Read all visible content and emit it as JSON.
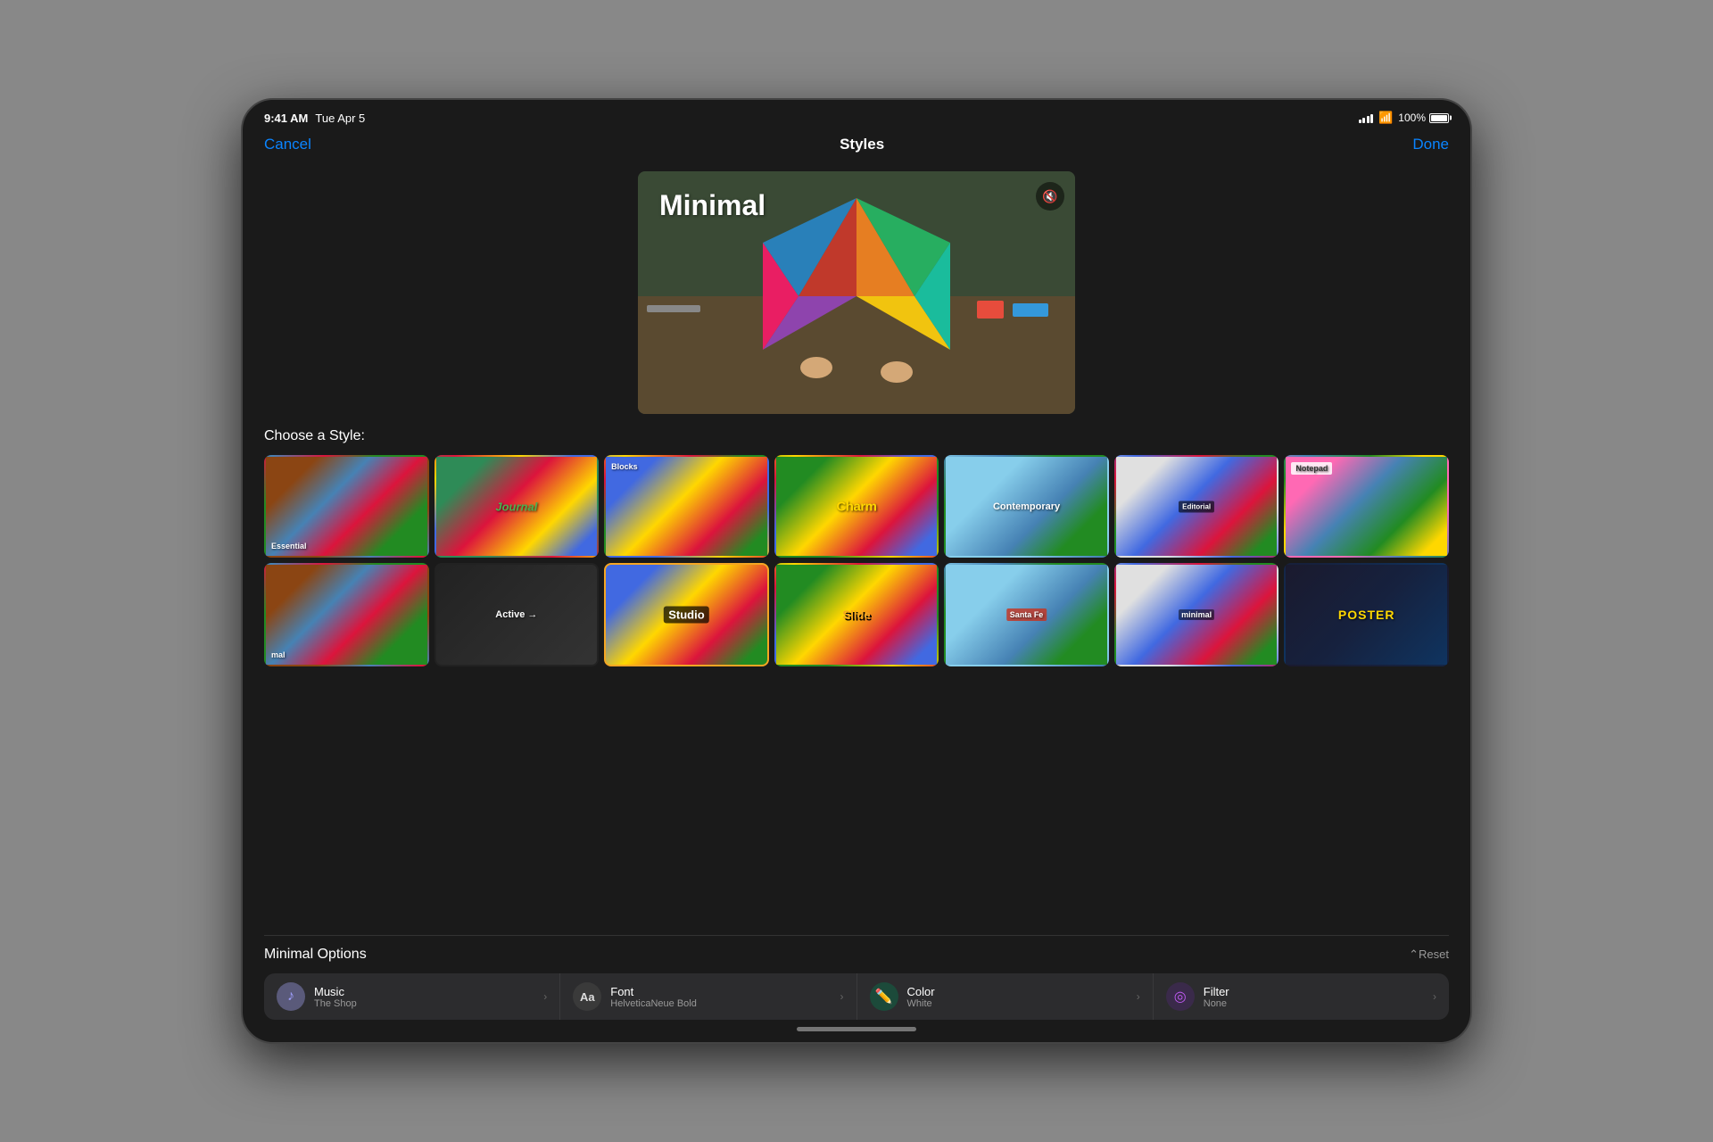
{
  "device": {
    "status_bar": {
      "time": "9:41 AM",
      "date": "Tue Apr 5",
      "battery_percent": "100%"
    }
  },
  "navigation": {
    "cancel_label": "Cancel",
    "title": "Styles",
    "done_label": "Done"
  },
  "preview": {
    "title": "Minimal",
    "mute_label": "🔇"
  },
  "styles_section": {
    "label": "Choose a Style:",
    "styles": [
      {
        "id": "essential",
        "label": "Essential",
        "label_pos": "bottom-left",
        "label_style": "white",
        "selected": false
      },
      {
        "id": "journal",
        "label": "Journal",
        "label_pos": "center",
        "label_style": "green",
        "selected": false
      },
      {
        "id": "blocks",
        "label": "Blocks",
        "label_pos": "top-left",
        "label_style": "white",
        "selected": false
      },
      {
        "id": "charm",
        "label": "Charm",
        "label_pos": "center",
        "label_style": "yellow",
        "selected": false
      },
      {
        "id": "contemporary",
        "label": "Contemporary",
        "label_pos": "center",
        "label_style": "white",
        "selected": false
      },
      {
        "id": "editorial",
        "label": "Editorial",
        "label_pos": "center",
        "label_style": "editorial",
        "selected": false
      },
      {
        "id": "notepad",
        "label": "Notepad",
        "label_pos": "top-left",
        "label_style": "notepad",
        "selected": false
      },
      {
        "id": "minimal",
        "label": "mal",
        "label_pos": "bottom-left",
        "label_style": "white",
        "selected": false
      },
      {
        "id": "active",
        "label": "Active →",
        "label_pos": "center",
        "label_style": "white",
        "selected": false
      },
      {
        "id": "studio",
        "label": "Studio",
        "label_pos": "center",
        "label_style": "studio",
        "selected": true
      },
      {
        "id": "slide",
        "label": "Slide",
        "label_pos": "center",
        "label_style": "slide",
        "selected": false
      },
      {
        "id": "santa-fe",
        "label": "Santa Fe",
        "label_pos": "center",
        "label_style": "white",
        "selected": false
      },
      {
        "id": "minimal2",
        "label": "minimal",
        "label_pos": "center",
        "label_style": "minimal-small",
        "selected": false
      },
      {
        "id": "poster",
        "label": "POSTER",
        "label_pos": "center",
        "label_style": "poster",
        "selected": false
      }
    ]
  },
  "options_section": {
    "title": "Minimal Options",
    "reset_label": "⌃Reset",
    "options": [
      {
        "id": "music",
        "icon": "♪",
        "icon_class": "music",
        "name": "Music",
        "value": "The Shop"
      },
      {
        "id": "font",
        "icon": "Aa",
        "icon_class": "font",
        "name": "Font",
        "value": "HelveticaNeue Bold"
      },
      {
        "id": "color",
        "icon": "✏",
        "icon_class": "color",
        "name": "Color",
        "value": "White"
      },
      {
        "id": "filter",
        "icon": "◎",
        "icon_class": "filter",
        "name": "Filter",
        "value": "None"
      }
    ]
  }
}
